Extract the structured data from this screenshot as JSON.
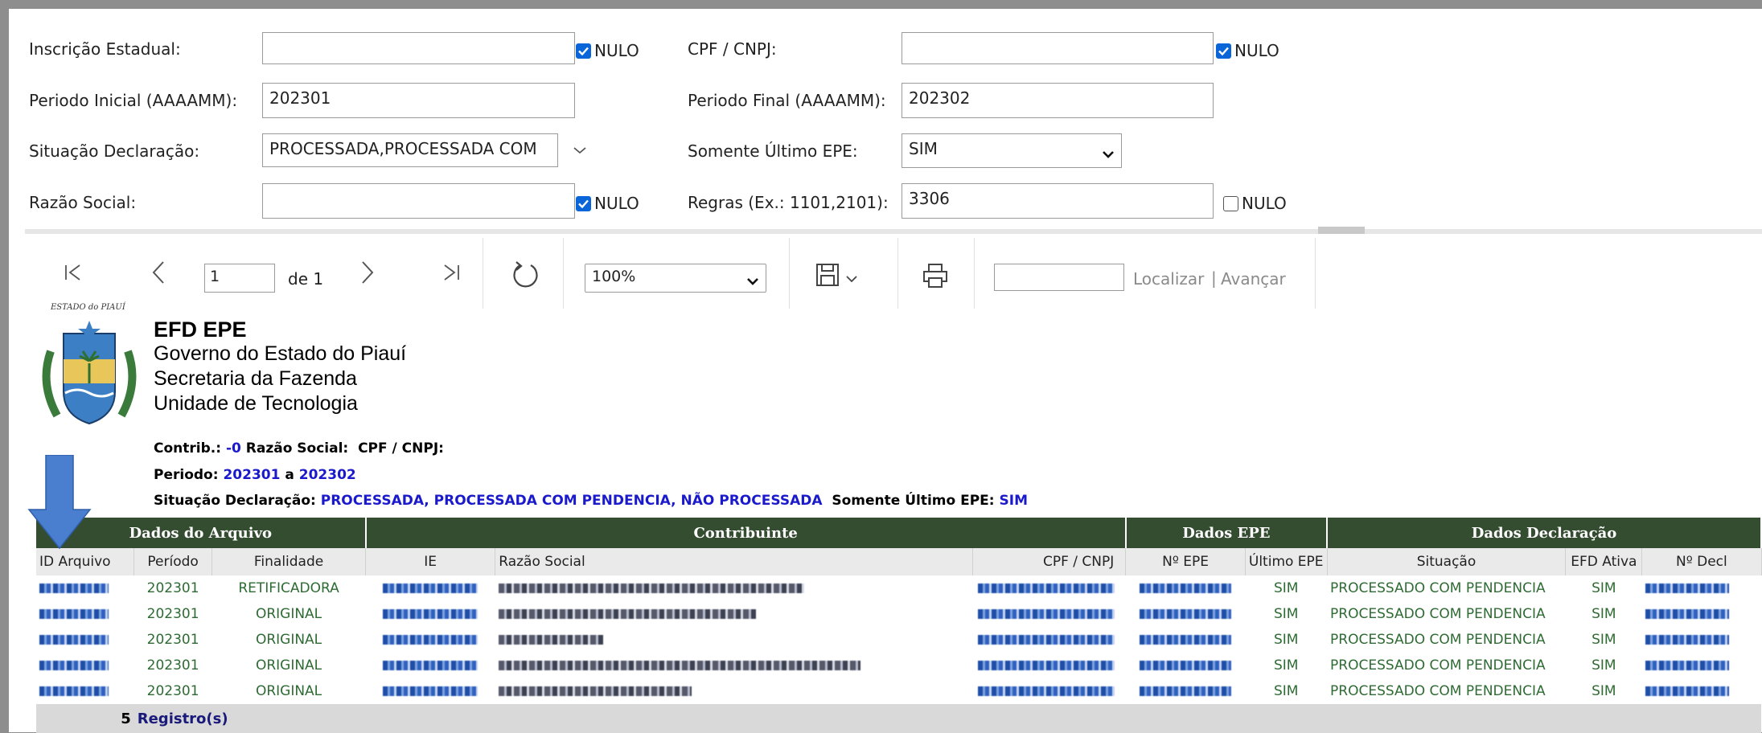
{
  "filters": {
    "inscricao_label": "Inscrição Estadual:",
    "inscricao_value": "",
    "cpf_label": "CPF / CNPJ:",
    "cpf_value": "",
    "periodo_inicial_label": "Periodo Inicial (AAAAMM):",
    "periodo_inicial_value": "202301",
    "periodo_final_label": "Periodo Final (AAAAMM):",
    "periodo_final_value": "202302",
    "situacao_label": "Situação Declaração:",
    "situacao_value": "PROCESSADA,PROCESSADA COM",
    "somente_label": "Somente Último EPE:",
    "somente_value": "SIM",
    "razao_label": "Razão Social:",
    "razao_value": "",
    "regras_label": "Regras (Ex.: 1101,2101):",
    "regras_value": "3306",
    "nulo_label": "NULO",
    "nulo_inscricao_checked": true,
    "nulo_cpf_checked": true,
    "nulo_razao_checked": true,
    "nulo_regras_checked": false
  },
  "toolbar": {
    "page_value": "1",
    "page_of": "de 1",
    "zoom": "100%",
    "find_value": "",
    "find_label": "Localizar",
    "next_label": "Avançar",
    "separator": "|"
  },
  "report": {
    "title": "EFD EPE",
    "line1": "Governo do Estado do Piauí",
    "line2": "Secretaria da Fazenda",
    "line3": "Unidade de Tecnologia",
    "seal_text": "ESTADO do PIAUÍ",
    "contrib_label": "Contrib.:",
    "contrib_value": "-0",
    "razao_label": "Razão Social:",
    "cpf_label": "CPF / CNPJ:",
    "periodo_label": "Periodo:",
    "periodo_from": "202301",
    "periodo_a": "a",
    "periodo_to": "202302",
    "situacao_label": "Situação Declaração:",
    "situacao_value": "PROCESSADA, PROCESSADA COM PENDENCIA, NÃO PROCESSADA",
    "somente_label": "Somente Último EPE:",
    "somente_value": "SIM"
  },
  "table": {
    "groups": [
      "Dados do Arquivo",
      "Contribuinte",
      "Dados EPE",
      "Dados Declaração"
    ],
    "columns": [
      "ID Arquivo",
      "Período",
      "Finalidade",
      "IE",
      "Razão Social",
      "CPF / CNPJ",
      "Nº EPE",
      "Último EPE",
      "Situação",
      "EFD Ativa",
      "Nº Decl"
    ],
    "rows": [
      {
        "periodo": "202301",
        "finalidade": "RETIFICADORA",
        "ultimo": "SIM",
        "situacao": "PROCESSADO COM PENDENCIA",
        "efd": "SIM"
      },
      {
        "periodo": "202301",
        "finalidade": "ORIGINAL",
        "ultimo": "SIM",
        "situacao": "PROCESSADO COM PENDENCIA",
        "efd": "SIM"
      },
      {
        "periodo": "202301",
        "finalidade": "ORIGINAL",
        "ultimo": "SIM",
        "situacao": "PROCESSADO COM PENDENCIA",
        "efd": "SIM"
      },
      {
        "periodo": "202301",
        "finalidade": "ORIGINAL",
        "ultimo": "SIM",
        "situacao": "PROCESSADO COM PENDENCIA",
        "efd": "SIM"
      },
      {
        "periodo": "202301",
        "finalidade": "ORIGINAL",
        "ultimo": "SIM",
        "situacao": "PROCESSADO COM PENDENCIA",
        "efd": "SIM"
      }
    ],
    "footer_count": "5",
    "footer_label": "Registro(s)"
  },
  "colors": {
    "header_green": "#344d31",
    "value_green": "#2e6b33",
    "link_blue": "#1a1acc",
    "checkbox_blue": "#0a66d8",
    "arrow_blue": "#4a7fd0"
  }
}
